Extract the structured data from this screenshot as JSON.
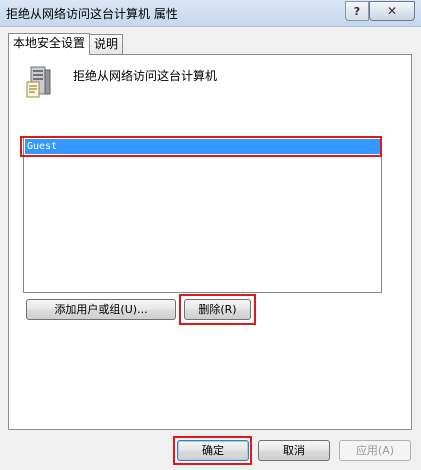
{
  "window": {
    "title": "拒绝从网络访问这台计算机 属性",
    "help_glyph": "?",
    "close_glyph": "✕"
  },
  "tabs": [
    {
      "label": "本地安全设置",
      "active": true
    },
    {
      "label": "说明",
      "active": false
    }
  ],
  "policy": {
    "name": "拒绝从网络访问这台计算机",
    "icon": "server-icon"
  },
  "list": {
    "items": [
      "Guest"
    ],
    "selected_index": 0
  },
  "actions": {
    "add_label": "添加用户或组(U)...",
    "remove_label": "删除(R)"
  },
  "footer": {
    "ok_label": "确定",
    "cancel_label": "取消",
    "apply_label": "应用(A)"
  },
  "colors": {
    "selection": "#3399ff",
    "highlight_box": "#e01818"
  }
}
